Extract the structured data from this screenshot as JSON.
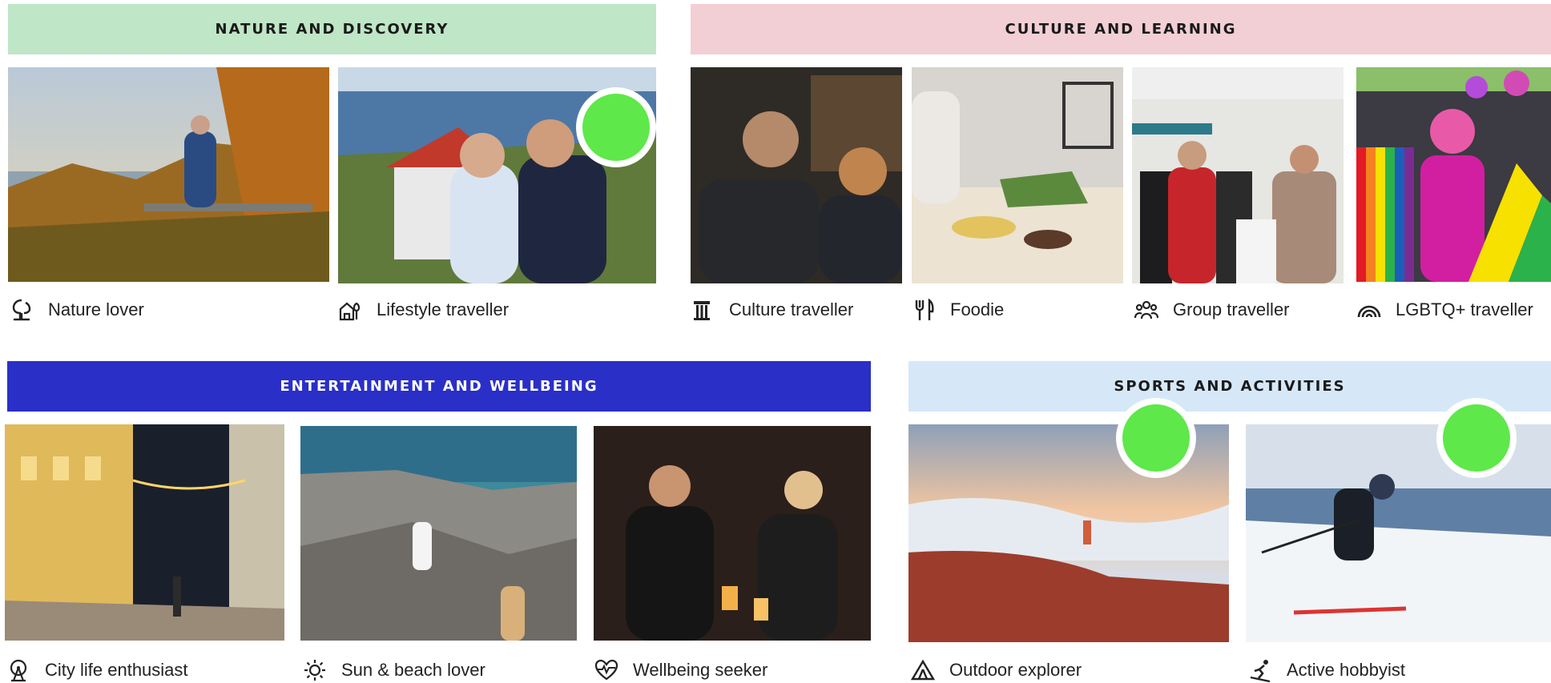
{
  "categories": {
    "nature": {
      "title": "NATURE AND DISCOVERY",
      "color": "#bfe6c7",
      "text_color": "#1a1a1a"
    },
    "culture": {
      "title": "CULTURE AND LEARNING",
      "color": "#f2cfd5",
      "text_color": "#1a1a1a"
    },
    "entertainment": {
      "title": "ENTERTAINMENT AND WELLBEING",
      "color": "#2a2fc7",
      "text_color": "#ffffff"
    },
    "sports": {
      "title": "SPORTS AND ACTIVITIES",
      "color": "#d6e8f8",
      "text_color": "#1a1a1a"
    }
  },
  "personas": [
    {
      "key": "nature-lover",
      "label": "Nature lover",
      "icon": "tree-icon"
    },
    {
      "key": "lifestyle-traveller",
      "label": "Lifestyle traveller",
      "icon": "house-tree-icon"
    },
    {
      "key": "culture-traveller",
      "label": "Culture traveller",
      "icon": "column-icon"
    },
    {
      "key": "foodie",
      "label": "Foodie",
      "icon": "fork-knife-icon"
    },
    {
      "key": "group-traveller",
      "label": "Group traveller",
      "icon": "group-icon"
    },
    {
      "key": "lgbtq-traveller",
      "label": "LGBTQ+ traveller",
      "icon": "rainbow-icon"
    },
    {
      "key": "city-life-enthusiast",
      "label": "City life enthusiast",
      "icon": "ferris-wheel-icon"
    },
    {
      "key": "sun-beach-lover",
      "label": "Sun & beach lover",
      "icon": "sun-icon"
    },
    {
      "key": "wellbeing-seeker",
      "label": "Wellbeing seeker",
      "icon": "heart-pulse-icon"
    },
    {
      "key": "outdoor-explorer",
      "label": "Outdoor explorer",
      "icon": "tent-icon"
    },
    {
      "key": "active-hobbyist",
      "label": "Active hobbyist",
      "icon": "skier-icon"
    }
  ],
  "markers": {
    "color": "#5ee84a"
  }
}
